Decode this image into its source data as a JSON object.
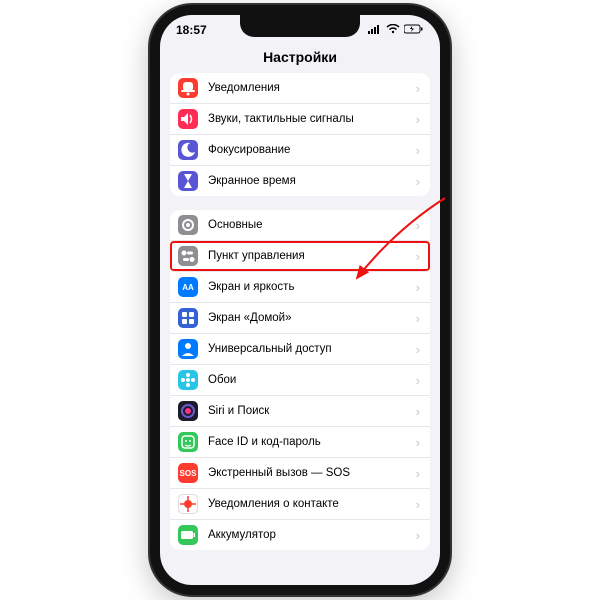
{
  "status": {
    "time": "18:57"
  },
  "header": {
    "title": "Настройки"
  },
  "group1": [
    {
      "label": "Уведомления",
      "bg": "#ff3b30",
      "glyph": "bell"
    },
    {
      "label": "Звуки, тактильные сигналы",
      "bg": "#ff2d55",
      "glyph": "speaker"
    },
    {
      "label": "Фокусирование",
      "bg": "#5856d6",
      "glyph": "moon"
    },
    {
      "label": "Экранное время",
      "bg": "#5856d6",
      "glyph": "hourglass"
    }
  ],
  "group2": [
    {
      "label": "Основные",
      "bg": "#8e8e93",
      "glyph": "gear"
    },
    {
      "label": "Пункт управления",
      "bg": "#8e8e93",
      "glyph": "toggles",
      "highlight": true
    },
    {
      "label": "Экран и яркость",
      "bg": "#007aff",
      "glyph": "AA"
    },
    {
      "label": "Экран «Домой»",
      "bg": "#3560d6",
      "glyph": "grid"
    },
    {
      "label": "Универсальный доступ",
      "bg": "#007aff",
      "glyph": "person"
    },
    {
      "label": "Обои",
      "bg": "#29c5e6",
      "glyph": "flower"
    },
    {
      "label": "Siri и Поиск",
      "bg": "#1b1b2b",
      "glyph": "siri"
    },
    {
      "label": "Face ID и код-пароль",
      "bg": "#34c759",
      "glyph": "face"
    },
    {
      "label": "Экстренный вызов — SOS",
      "bg": "#ff3b30",
      "glyph": "SOS"
    },
    {
      "label": "Уведомления о контакте",
      "bg": "#ffffff",
      "glyph": "virus",
      "fg": "#ff3b30",
      "border": true
    },
    {
      "label": "Аккумулятор",
      "bg": "#34c759",
      "glyph": "battery"
    }
  ]
}
